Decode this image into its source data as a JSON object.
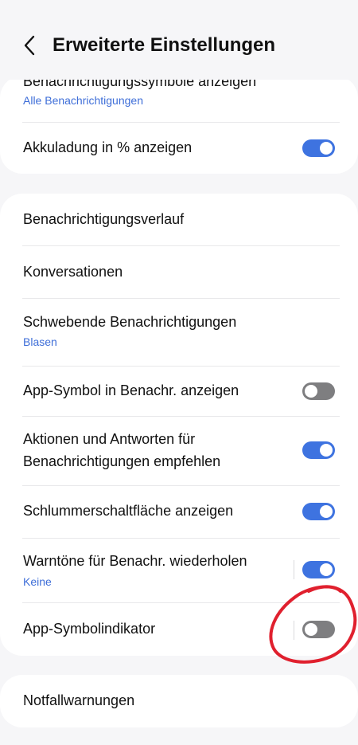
{
  "header": {
    "title": "Erweiterte Einstellungen",
    "back_icon": "chevron-left-icon"
  },
  "card1": {
    "items": [
      {
        "label": "Benachrichtigungssymbole anzeigen",
        "subtitle": "Alle Benachrichtigungen"
      },
      {
        "label": "Akkuladung in % anzeigen",
        "toggle": true
      }
    ]
  },
  "card2": {
    "items": [
      {
        "label": "Benachrichtigungsverlauf"
      },
      {
        "label": "Konversationen"
      },
      {
        "label": "Schwebende Benachrichtigungen",
        "subtitle": "Blasen"
      },
      {
        "label": "App-Symbol in Benachr. anzeigen",
        "toggle": false
      },
      {
        "label_line1": "Aktionen und Antworten für",
        "label_line2": "Benachrichtigungen empfehlen",
        "toggle": true
      },
      {
        "label": "Schlummerschaltfläche anzeigen",
        "toggle": true
      },
      {
        "label": "Warntöne für Benachr. wiederholen",
        "subtitle": "Keine",
        "toggle": true
      },
      {
        "label": "App-Symbolindikator",
        "toggle": false
      }
    ]
  },
  "card3": {
    "items": [
      {
        "label": "Notfallwarnungen"
      }
    ]
  },
  "colors": {
    "accent": "#3e73e0",
    "subtitle": "#3e6ed8",
    "toggle_off": "#7e7e80",
    "annotation": "#e0202e",
    "background": "#f6f6f8"
  }
}
